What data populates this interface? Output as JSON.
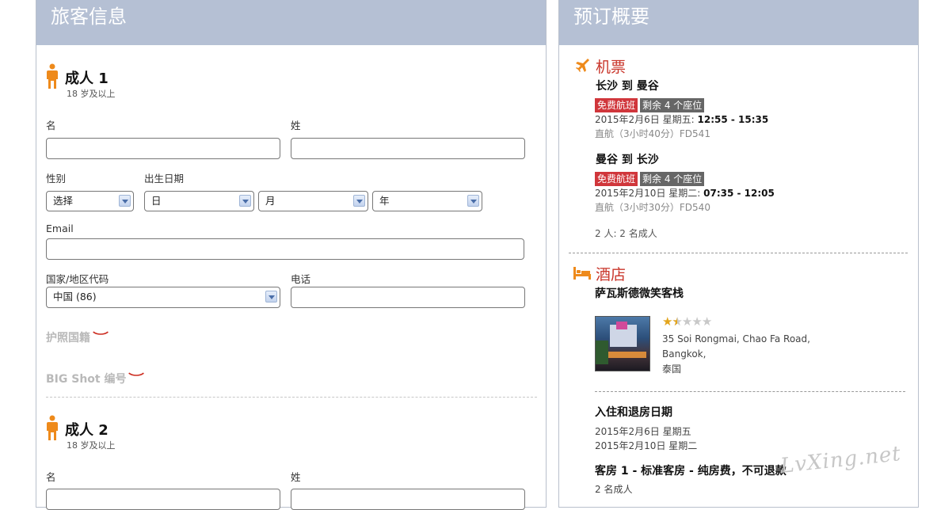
{
  "left_panel": {
    "title": "旅客信息",
    "adults": [
      {
        "heading": "成人 1",
        "subtitle": "18 岁及以上",
        "first_name_label": "名",
        "last_name_label": "姓",
        "gender_label": "性别",
        "gender_value": "选择",
        "dob_label": "出生日期",
        "dob_day": "日",
        "dob_month": "月",
        "dob_year": "年",
        "email_label": "Email",
        "country_code_label": "国家/地区代码",
        "country_code_value": "中国 (86)",
        "phone_label": "电话",
        "passport_link": "护照国籍",
        "bigshot_link": "BIG Shot 编号"
      },
      {
        "heading": "成人 2",
        "subtitle": "18 岁及以上",
        "first_name_label": "名",
        "last_name_label": "姓"
      }
    ]
  },
  "right_panel": {
    "title": "预订概要",
    "flight": {
      "section_title": "机票",
      "icon": "plane-icon",
      "legs": [
        {
          "route": "长沙 到 曼谷",
          "badge_free": "免费航班",
          "badge_seats": "剩余 4 个座位",
          "date": "2015年2月6日 星期五:",
          "time": "12:55 - 15:35",
          "detail": "直航（3小时40分）FD541"
        },
        {
          "route": "曼谷 到 长沙",
          "badge_free": "免费航班",
          "badge_seats": "剩余 4 个座位",
          "date": "2015年2月10日 星期二:",
          "time": "07:35 - 12:05",
          "detail": "直航（3小时30分）FD540"
        }
      ],
      "passengers": "2 人:  2 名成人"
    },
    "hotel": {
      "section_title": "酒店",
      "icon": "bed-icon",
      "name": "萨瓦斯德微笑客栈",
      "rating": 1.5,
      "rating_max": 5,
      "address_line1": "35 Soi Rongmai, Chao Fa Road,",
      "address_line2": "Bangkok,",
      "address_line3": "泰国",
      "checkin_title": "入住和退房日期",
      "checkin_date": "2015年2月6日 星期五",
      "checkout_date": "2015年2月10日 星期二",
      "room_title": "客房 1 - 标准客房 - 纯房费，不可退款",
      "room_guests": "2 名成人"
    }
  },
  "watermark": "LvXing.net",
  "colors": {
    "header_bg": "#b5c0d4",
    "accent_orange": "#ee8a1b",
    "section_red": "#c9352a",
    "badge_red": "#d0363b"
  }
}
